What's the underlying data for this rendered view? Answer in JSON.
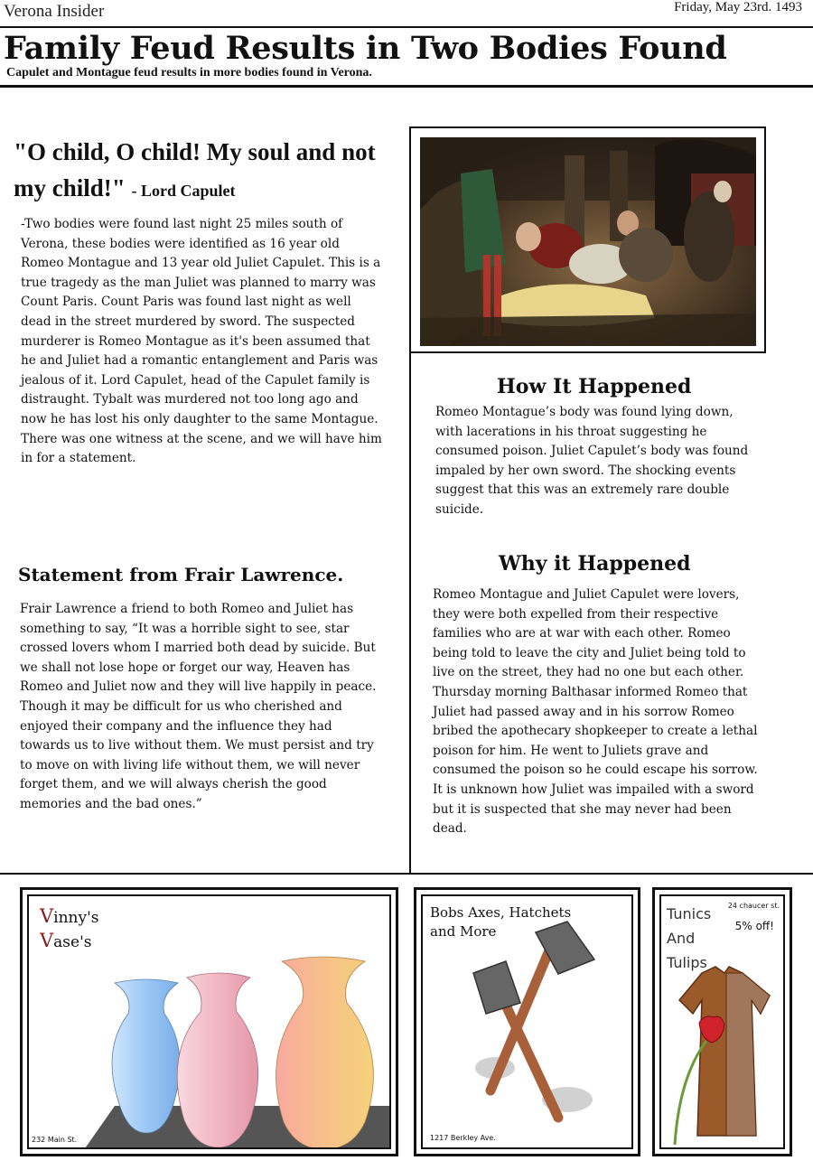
{
  "masthead": {
    "name": "Verona Insider",
    "date": "Friday, May 23rd. 1493"
  },
  "headline": "Family Feud Results in Two Bodies Found",
  "subheadline": "Capulet and Montague feud results in more bodies found in Verona.",
  "quote": {
    "text": "\"O child, O child! My soul and not my child!\"",
    "attribution": "- Lord Capulet"
  },
  "story": {
    "text": "-Two bodies were found last night 25 miles south of Verona, these bodies were identified as 16 year old Romeo Montague and 13 year old Juliet Capulet. This is a true tragedy as the man Juliet was planned to marry was Count Paris. Count Paris was found last night as well dead in the street murdered by sword. The suspected murderer is Romeo Montague as it's been assumed that he and Juliet had a romantic entanglement and Paris was jealous of it. Lord Capulet, head of the Capulet family is distraught. Tybalt was murdered not too long ago and now he has lost his only daughter to the same Montague. There was one witness at the scene, and we will have him in for a statement."
  },
  "friar": {
    "heading": "Statement from Frair Lawrence.",
    "text": "Frair Lawrence a friend to both Romeo and Juliet has something to say, “It was a horrible sight to see, star crossed lovers whom I married both dead by suicide. But we shall not lose hope or forget our way, Heaven has Romeo and Juliet now and they will live happily in peace. Though it may be difficult for us who cherished and enjoyed their company and the influence they had towards us to live without them. We must persist and try to move on with living life without them, we will never forget them, and we will always cherish the good memories and the bad ones.”"
  },
  "how": {
    "heading": "How It Happened",
    "text": "Romeo Montague’s body was found lying down, with lacerations in his throat suggesting he consumed poison. Juliet Capulet’s body was found impaled by her own sword. The shocking events suggest that this was an extremely rare double suicide."
  },
  "why": {
    "heading": "Why it Happened",
    "text": "Romeo Montague and Juliet Capulet were lovers, they were both expelled from their respective families who are at war with each other. Romeo being told to leave the city and Juliet being told to live on the street, they had no one but each other. Thursday morning Balthasar informed Romeo that Juliet had passed away and in his sorrow Romeo bribed the apothecary shopkeeper to create a lethal poison for him. He went to Juliets grave and consumed the poison so he could escape his sorrow. It is unknown how Juliet was impailed with a sword but it is suspected that she may never had been dead."
  },
  "ads": {
    "vinny": {
      "initial1": "V",
      "rest1": "inny's",
      "initial2": "V",
      "rest2": "ase's",
      "address": "232 Main St."
    },
    "bobs": {
      "title": "Bobs Axes, Hatchets and More",
      "address": "1217 Berkley Ave."
    },
    "tunics": {
      "line1": "Tunics",
      "line2": "And",
      "line3": "Tulips",
      "address": "24 chaucer st.",
      "discount": "5% off!"
    }
  },
  "colors": {
    "ink": "#111111",
    "vinny_red": "#8b1a1a",
    "vase_blue": "#9cc8f5",
    "vase_pink": "#f2b6c2",
    "vase_orange": "#f7c08a",
    "tunic_brown": "#9b5a2a",
    "tulip_red": "#d0222a"
  }
}
